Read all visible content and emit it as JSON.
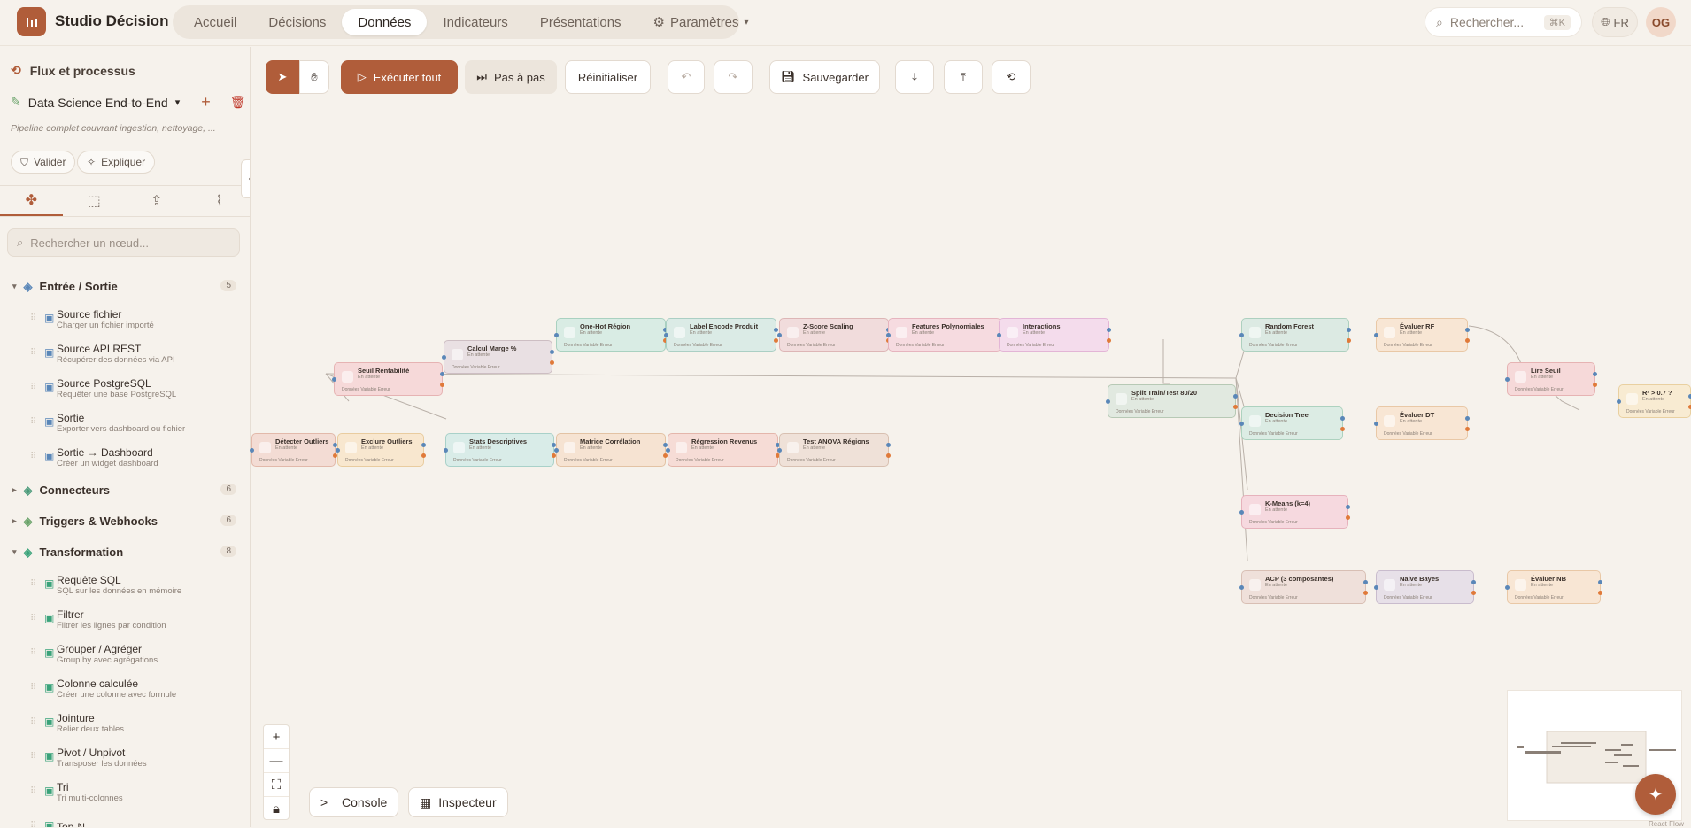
{
  "app": {
    "title": "Studio Décision"
  },
  "nav": {
    "items": [
      {
        "label": "Accueil",
        "active": false
      },
      {
        "label": "Décisions",
        "active": false
      },
      {
        "label": "Données",
        "active": true
      },
      {
        "label": "Indicateurs",
        "active": false
      },
      {
        "label": "Présentations",
        "active": false
      },
      {
        "label": "Paramètres",
        "active": false
      }
    ]
  },
  "search": {
    "placeholder": "Rechercher...",
    "shortcut": "⌘K"
  },
  "lang": "FR",
  "user": {
    "initials": "OG"
  },
  "sidebar": {
    "title": "Flux et processus",
    "pipeline_name": "Data Science End-to-End",
    "pipeline_desc": "Pipeline complet couvrant ingestion, nettoyage, ...",
    "validate_label": "Valider",
    "explain_label": "Expliquer",
    "node_search_placeholder": "Rechercher un nœud...",
    "categories": [
      {
        "name": "Entrée / Sortie",
        "count": "5",
        "expanded": true,
        "items": [
          {
            "name": "Source fichier",
            "desc": "Charger un fichier importé"
          },
          {
            "name": "Source API REST",
            "desc": "Récupérer des données via API"
          },
          {
            "name": "Source PostgreSQL",
            "desc": "Requêter une base PostgreSQL"
          },
          {
            "name": "Sortie",
            "desc": "Exporter vers dashboard ou fichier"
          },
          {
            "name": "Sortie → Dashboard",
            "desc": "Créer un widget dashboard"
          }
        ]
      },
      {
        "name": "Connecteurs",
        "count": "6",
        "expanded": false,
        "items": []
      },
      {
        "name": "Triggers & Webhooks",
        "count": "6",
        "expanded": false,
        "items": []
      },
      {
        "name": "Transformation",
        "count": "8",
        "expanded": true,
        "items": [
          {
            "name": "Requête SQL",
            "desc": "SQL sur les données en mémoire"
          },
          {
            "name": "Filtrer",
            "desc": "Filtrer les lignes par condition"
          },
          {
            "name": "Grouper / Agréger",
            "desc": "Group by avec agrégations"
          },
          {
            "name": "Colonne calculée",
            "desc": "Créer une colonne avec formule"
          },
          {
            "name": "Jointure",
            "desc": "Relier deux tables"
          },
          {
            "name": "Pivot / Unpivot",
            "desc": "Transposer les données"
          },
          {
            "name": "Tri",
            "desc": "Tri multi-colonnes"
          },
          {
            "name": "Top-N",
            "desc": ""
          }
        ]
      }
    ]
  },
  "toolbar": {
    "run_all": "Exécuter tout",
    "step": "Pas à pas",
    "reset": "Réinitialiser",
    "save": "Sauvegarder"
  },
  "bottom": {
    "console": "Console",
    "inspector": "Inspecteur"
  },
  "node_status": "En attente",
  "node_ports": [
    "Données",
    "Variable",
    "Erreur"
  ],
  "nodes": [
    {
      "title": "Détecter Outliers",
      "color": "#f3dcd4",
      "border": "#e2b9aa"
    },
    {
      "title": "Exclure Outliers",
      "color": "#f8e7cf",
      "border": "#e9cc9f"
    },
    {
      "title": "Seuil Rentabilité",
      "color": "#f6d9d9",
      "border": "#e6b3b3"
    },
    {
      "title": "Calcul Marge %",
      "color": "#e9e0e3",
      "border": "#cdbec3"
    },
    {
      "title": "Stats Descriptives",
      "color": "#d9ece8",
      "border": "#a9d1c9"
    },
    {
      "title": "One-Hot Région",
      "color": "#d9ece4",
      "border": "#a9d1c0"
    },
    {
      "title": "Matrice Corrélation",
      "color": "#f6e3d2",
      "border": "#e3c3a4"
    },
    {
      "title": "Label Encode Produit",
      "color": "#dbebe6",
      "border": "#abcfc4"
    },
    {
      "title": "Régression Revenus",
      "color": "#f6dcd6",
      "border": "#e4b6ab"
    },
    {
      "title": "Z-Score Scaling",
      "color": "#f1dcdc",
      "border": "#ddb6b6"
    },
    {
      "title": "Test ANOVA Régions",
      "color": "#efe1d8",
      "border": "#d8c0b1"
    },
    {
      "title": "Features Polynomiales",
      "color": "#f6dbe0",
      "border": "#e6b4be"
    },
    {
      "title": "Interactions",
      "color": "#f4dcec",
      "border": "#e3b5d6"
    },
    {
      "title": "Split Train/Test 80/20",
      "color": "#e1e9e0",
      "border": "#b7c9b5"
    },
    {
      "title": "Random Forest",
      "color": "#dceae3",
      "border": "#add0bf"
    },
    {
      "title": "Decision Tree",
      "color": "#dcece4",
      "border": "#add2bf"
    },
    {
      "title": "K-Means (k=4)",
      "color": "#f6d9df",
      "border": "#e6b2bc"
    },
    {
      "title": "ACP (3 composantes)",
      "color": "#efe0da",
      "border": "#d8bfb4"
    },
    {
      "title": "Évaluer RF",
      "color": "#f8e6d4",
      "border": "#e9c8a6"
    },
    {
      "title": "Évaluer DT",
      "color": "#f8e6d4",
      "border": "#e9c8a6"
    },
    {
      "title": "Naive Bayes",
      "color": "#e7e0e8",
      "border": "#c9bccd"
    },
    {
      "title": "Lire Seuil",
      "color": "#f6d9d9",
      "border": "#e6b3b3"
    },
    {
      "title": "Évaluer NB",
      "color": "#f8e6d4",
      "border": "#e9c8a6"
    },
    {
      "title": "R² > 0.7 ?",
      "color": "#f8ebd2",
      "border": "#e9d0a0"
    }
  ],
  "attribution": "React Flow"
}
